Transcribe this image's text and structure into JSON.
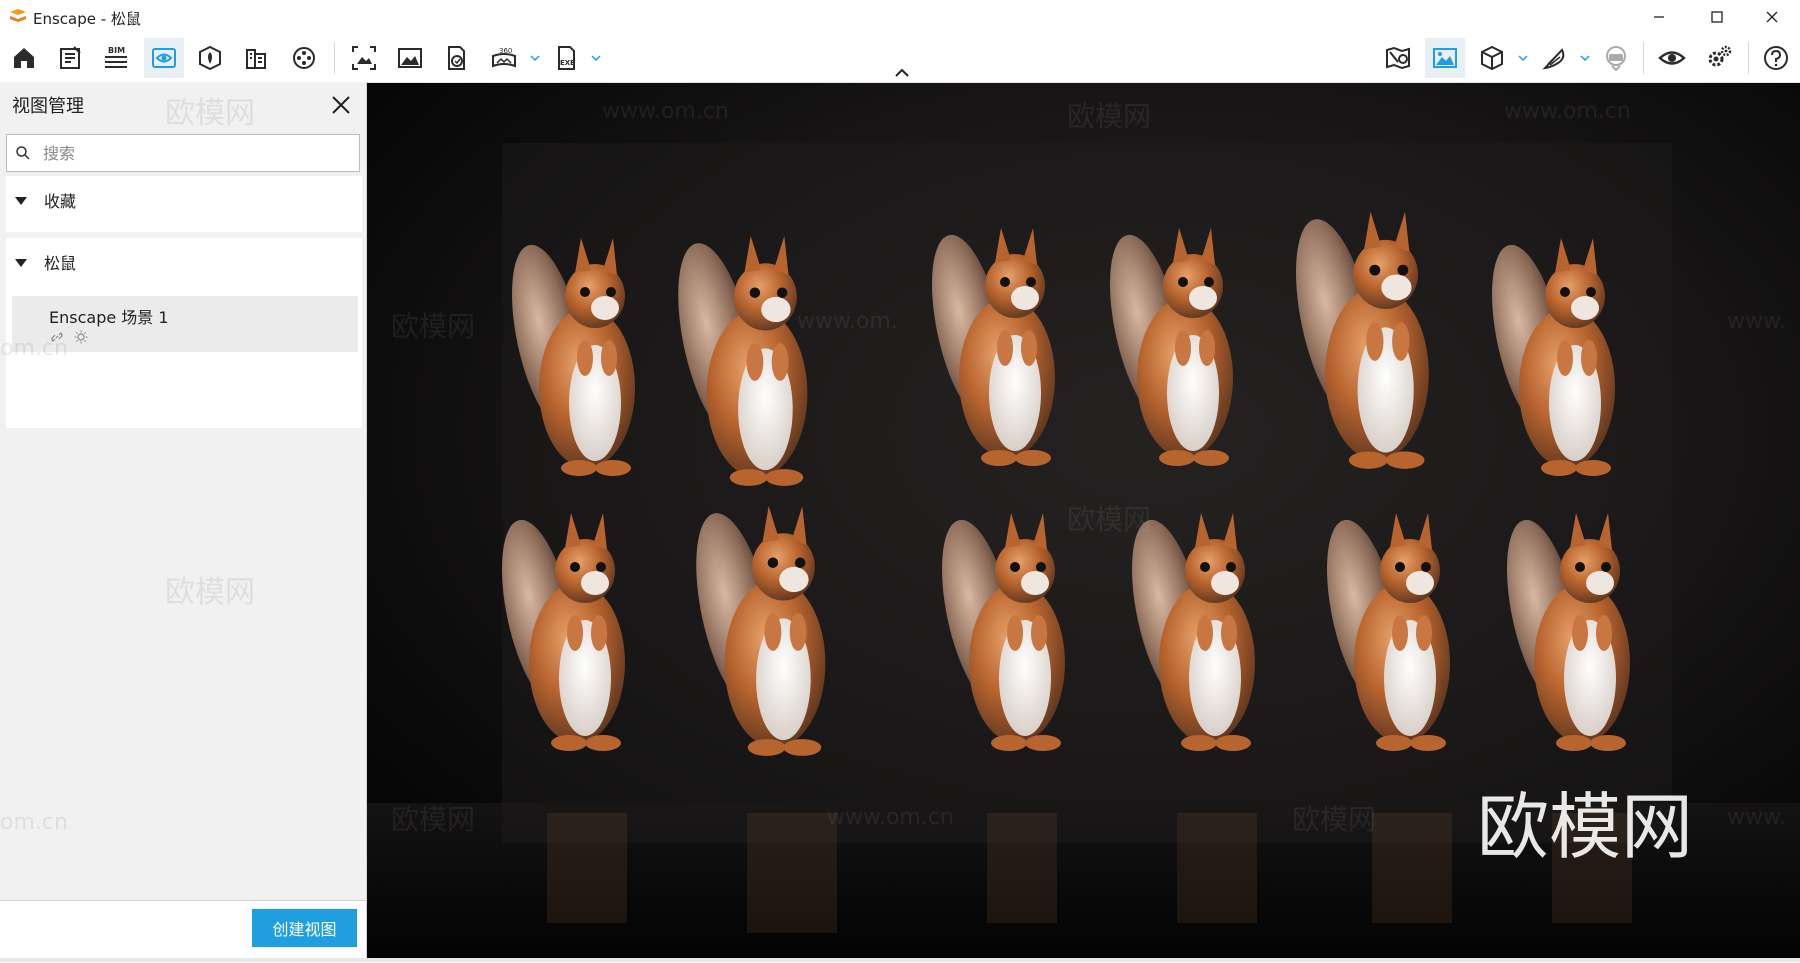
{
  "window": {
    "title": "Enscape - 松鼠",
    "minimize_icon": "minimize-icon",
    "maximize_icon": "maximize-icon",
    "close_icon": "close-icon"
  },
  "toolbar": {
    "left_tools": [
      "home-icon",
      "notes-icon",
      "bim-icon",
      "view-management-icon",
      "site-context-icon",
      "building-icon",
      "video-reel-icon",
      "screenshot-icon",
      "render-image-icon",
      "panorama-icon",
      "render-360-icon",
      "exe-export-icon"
    ],
    "bim_label": "BIM",
    "pano_label": "360",
    "exe_label": "EXE",
    "right_tools": [
      "map-icon",
      "image-view-icon",
      "cube-icon",
      "feather-icon",
      "vr-headset-icon",
      "eye-icon",
      "settings-icon",
      "help-icon"
    ],
    "active_tool": "view-management-icon",
    "accent": "#1f9fe0"
  },
  "sidebar": {
    "title": "视图管理",
    "search_placeholder": "搜索",
    "sections": [
      {
        "label": "收藏",
        "expanded": true,
        "items": []
      },
      {
        "label": "松鼠",
        "expanded": true,
        "items": [
          {
            "name": "Enscape 场景 1"
          }
        ]
      }
    ],
    "create_button": "创建视图",
    "watermarks": [
      "欧模网",
      "欧模网",
      "om.cn",
      "om.cn"
    ]
  },
  "viewport": {
    "watermarks": [
      "www.om.cn",
      "欧模网",
      "www.om.cn",
      "欧模网",
      "www.om.",
      "www.",
      "欧模网",
      "欧模网",
      "www.om.cn",
      "欧模网",
      "www."
    ],
    "main_watermark": "欧模网"
  }
}
